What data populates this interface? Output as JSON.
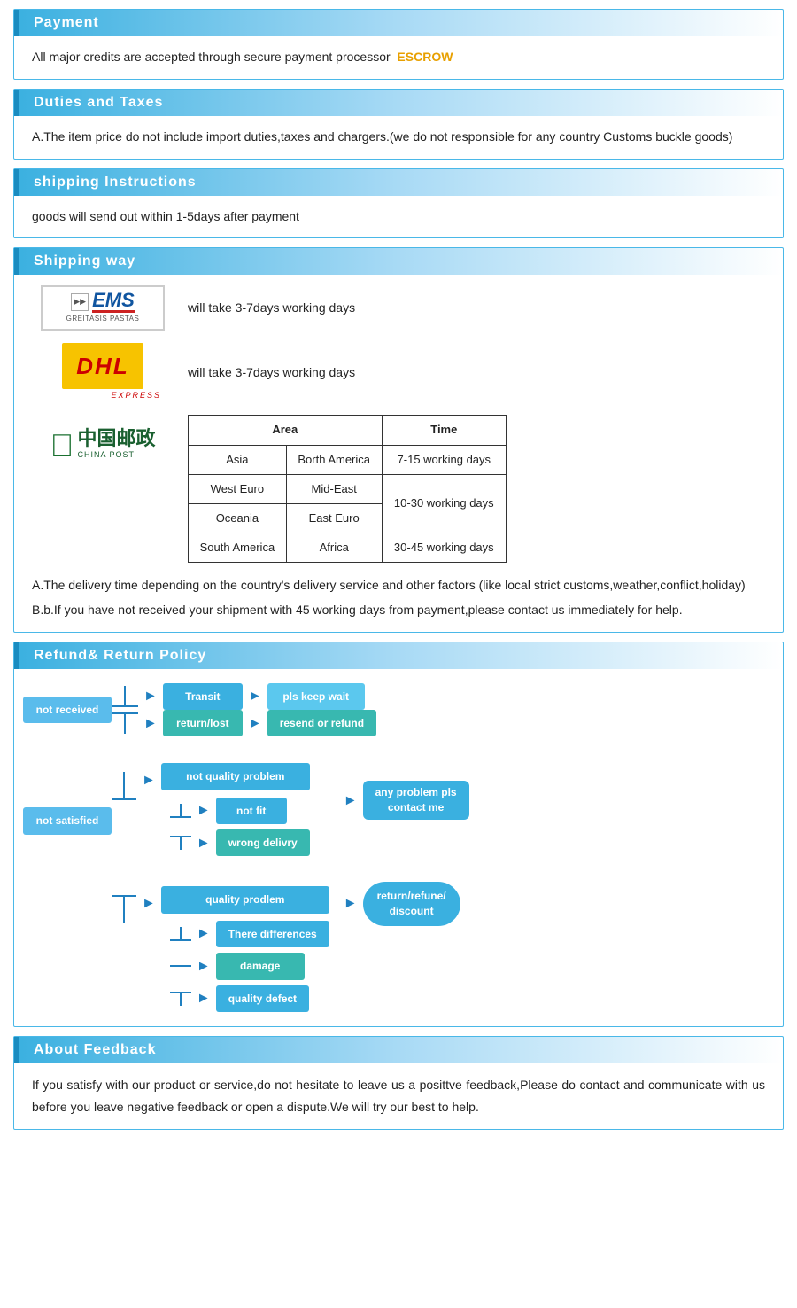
{
  "sections": {
    "payment": {
      "title": "Payment",
      "body": "All  major  credits  are  accepted  through  secure  payment  processor",
      "escrow": "ESCROW"
    },
    "duties": {
      "title": "Duties  and  Taxes",
      "body": "A.The  item  price  do  not  include  import  duties,taxes  and  chargers.(we  do  not  responsible  for  any  country  Customs  buckle  goods)"
    },
    "shipping_instructions": {
      "title": "shipping  Instructions",
      "body": "goods  will  send  out  within  1-5days  after  payment"
    },
    "shipping_way": {
      "title": "Shipping  way",
      "ems_text": "will  take  3-7days  working  days",
      "dhl_text": "will  take  3-7days  working  days",
      "table": {
        "headers": [
          "Area",
          "Time"
        ],
        "rows": [
          {
            "area1": "Asia",
            "area2": "Borth America",
            "time": "7-15 working days"
          },
          {
            "area1": "West Euro",
            "area2": "Mid-East",
            "time": "10-30 working days"
          },
          {
            "area1": "Oceania",
            "area2": "East Euro",
            "time": ""
          },
          {
            "area1": "South America",
            "area2": "Africa",
            "time": "30-45 working days"
          }
        ]
      },
      "note_a": "A.The  delivery  time  depending  on  the  country's  delivery  service  and  other  factors  (like  local  strict  customs,weather,conflict,holiday)",
      "note_b": "B.b.If  you  have  not  received  your  shipment  with  45  working  days  from  payment,please  contact  us  immediately  for  help."
    },
    "refund": {
      "title": "Refund&  Return  Policy",
      "not_received": "not  received",
      "transit": "Transit",
      "return_lost": "return/lost",
      "pls_keep_wait": "pls  keep  wait",
      "resend_or_refund": "resend  or  refund",
      "not_satisfied": "not  satisfied",
      "not_quality_problem": "not  quality  problem",
      "quality_prodlem": "quality  prodlem",
      "not_fit": "not  fit",
      "wrong_delivry": "wrong  delivry",
      "there_differences": "There  differences",
      "damage": "damage",
      "quality_defect": "quality  defect",
      "any_problem": "any  problem  pls\ncontact  me",
      "return_refund": "return/refune/\ndiscount"
    },
    "feedback": {
      "title": "About  Feedback",
      "body1": "If  you  satisfy  with  our  product  or  service,do  not  hesitate  to  leave  us  a  posittve  feedback,Please  do  contact  and  communicate  with  us  before  you  leave  negative  feedback  or  open  a  dispute.We  will  try  our  best  to  help."
    }
  }
}
